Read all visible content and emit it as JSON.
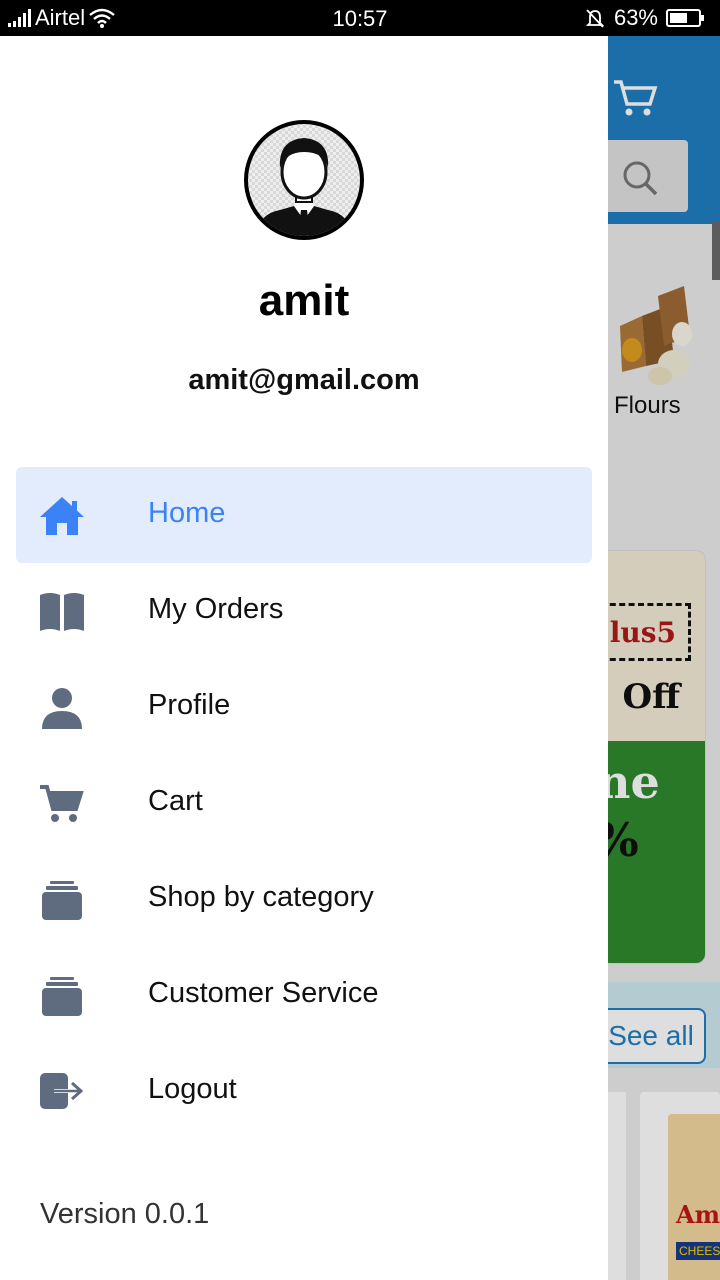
{
  "status_bar": {
    "carrier": "Airtel",
    "time": "10:57",
    "battery": "63%",
    "battery_level": 0.63
  },
  "background_app": {
    "category_label": "Flours",
    "promo_code_fragment": "lus5",
    "promo_off_fragment": "Off",
    "promo_green_line1": "ne",
    "promo_green_line2": "%",
    "see_all_label": "See all",
    "product_brand_fragment": "Amu",
    "product_type_fragment": "CHEESE"
  },
  "drawer": {
    "user_name": "amit",
    "user_email": "amit@gmail.com",
    "menu": [
      {
        "label": "Home",
        "icon": "home-icon",
        "active": true
      },
      {
        "label": "My Orders",
        "icon": "book-icon",
        "active": false
      },
      {
        "label": "Profile",
        "icon": "person-icon",
        "active": false
      },
      {
        "label": "Cart",
        "icon": "cart-icon",
        "active": false
      },
      {
        "label": "Shop by category",
        "icon": "stack-icon",
        "active": false
      },
      {
        "label": "Customer Service",
        "icon": "stack-icon",
        "active": false
      },
      {
        "label": "Logout",
        "icon": "logout-icon",
        "active": false
      }
    ],
    "version": "Version 0.0.1"
  },
  "colors": {
    "active_accent": "#3b82f6",
    "active_bg": "#e3ecfd",
    "icon_gray": "#5f6b7e",
    "app_header_blue": "#1f7fc0"
  }
}
